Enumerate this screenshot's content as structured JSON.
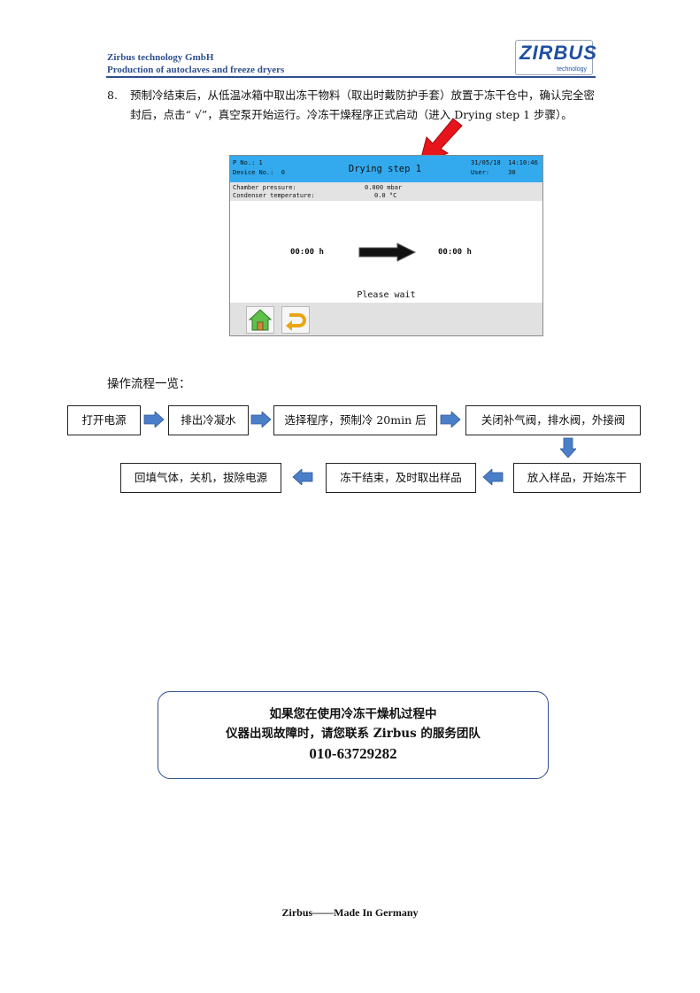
{
  "header": {
    "company_line1": "Zirbus technology GmbH",
    "company_line2": "Production of autoclaves and freeze dryers",
    "logo_text": "ZIRBUS",
    "logo_subtext": "technology"
  },
  "step": {
    "number": "8.",
    "text": "预制冷结束后，从低温冰箱中取出冻干物料（取出时戴防护手套）放置于冻干仓中，确认完全密封后，点击“ √”，真空泵开始运行。冷冻干燥程序正式启动（进入 Drying step 1 步骤）。"
  },
  "screen": {
    "p_no": "P No.: 1",
    "device_no": "Device No.:  0",
    "title": "Drying step 1",
    "date_time": "31/05/18  14:10:46",
    "user": "User:     30",
    "chamber_label": "Chamber pressure:",
    "chamber_value": "0.000 mbar",
    "condenser_label": "Condenser temperature:",
    "condenser_value": "0.0 °C",
    "time_left": "00:00 h",
    "time_right": "00:00 h",
    "wait_text": "Please wait",
    "buttons": [
      "home-icon",
      "return-icon"
    ],
    "accent_color": "#33aaee"
  },
  "flow": {
    "title": "操作流程一览：",
    "steps": [
      "打开电源",
      "排出冷凝水",
      "选择程序，预制冷 20min 后",
      "关闭补气阀，排水阀，外接阀",
      "放入样品，开始冻干",
      "冻干结束，及时取出样品",
      "回填气体，关机，拔除电源"
    ],
    "arrow_color": "#4a7ec8"
  },
  "notice": {
    "line1": "如果您在使用冷冻干燥机过程中",
    "line2": "仪器出现故障时，请您联系 Zirbus 的服务团队",
    "phone": "010-63729282"
  },
  "footer": {
    "text": "Zirbus——Made In Germany"
  }
}
